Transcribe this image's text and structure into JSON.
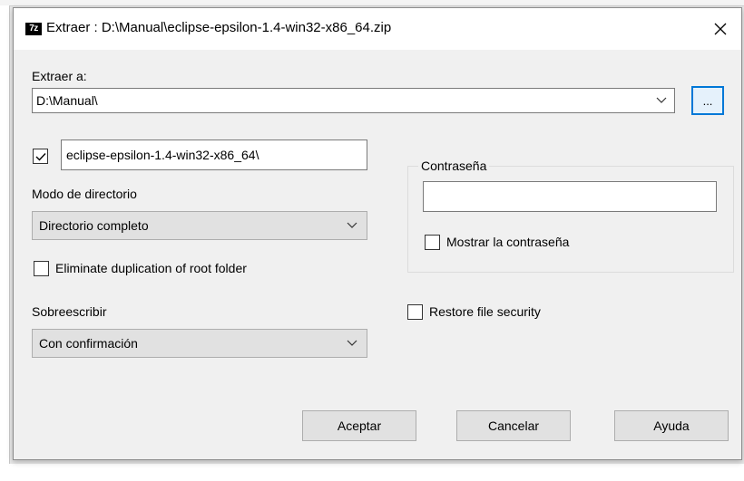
{
  "window": {
    "title": "Extraer : D:\\Manual\\eclipse-epsilon-1.4-win32-x86_64.zip",
    "icon_text": "7z",
    "close_glyph": "✕"
  },
  "extract_to": {
    "label": "Extraer a:",
    "value": "D:\\Manual\\",
    "browse_label": "..."
  },
  "subfolder": {
    "checked": true,
    "value": "eclipse-epsilon-1.4-win32-x86_64\\"
  },
  "path_mode": {
    "label": "Modo de directorio",
    "selected": "Directorio completo"
  },
  "eliminate_dup": {
    "label": "Eliminate duplication of root folder",
    "checked": false
  },
  "overwrite": {
    "label": "Sobreescribir",
    "selected": "Con confirmación"
  },
  "password": {
    "group_label": "Contraseña",
    "value": "",
    "show_label": "Mostrar la contraseña",
    "show_checked": false
  },
  "restore_security": {
    "label": "Restore file security",
    "checked": false
  },
  "buttons": {
    "ok": "Aceptar",
    "cancel": "Cancelar",
    "help": "Ayuda"
  },
  "icons": [
    "7zip-app-icon",
    "close-icon",
    "chevron-down-icon",
    "checkmark-icon"
  ],
  "colors": {
    "dialog_bg": "#f0f0f0",
    "focus_border": "#0078d7",
    "button_bg": "#e1e1e1"
  }
}
